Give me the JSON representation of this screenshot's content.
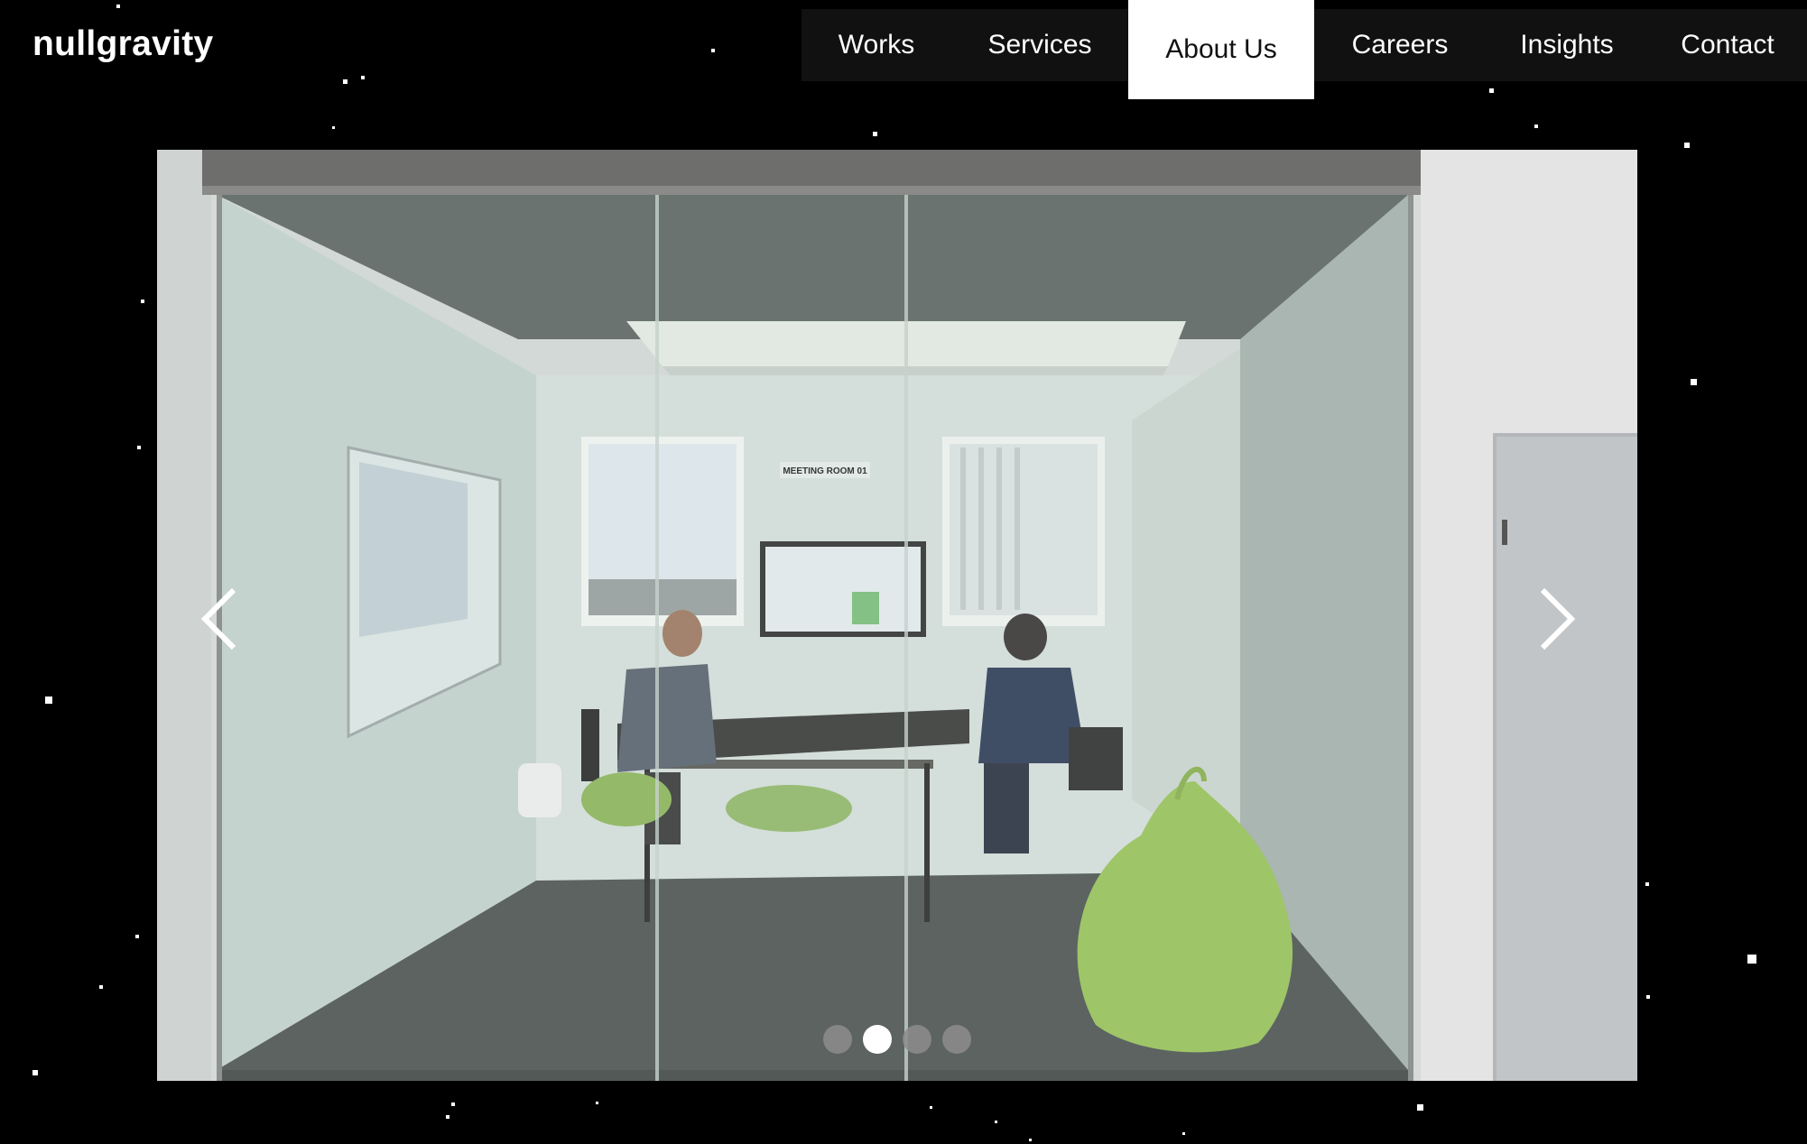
{
  "brand": {
    "logo_text": "nullgravity"
  },
  "nav": {
    "items": [
      {
        "label": "Works",
        "active": false
      },
      {
        "label": "Services",
        "active": false
      },
      {
        "label": "About Us",
        "active": true
      },
      {
        "label": "Careers",
        "active": false
      },
      {
        "label": "Insights",
        "active": false
      },
      {
        "label": "Contact",
        "active": false
      }
    ]
  },
  "slider": {
    "sign_text": "MEETING ROOM 01",
    "prev_icon": "chevron-left-icon",
    "next_icon": "chevron-right-icon",
    "slide_count": 4,
    "active_slide_index": 1
  },
  "colors": {
    "background": "#000000",
    "nav_bg": "#111111",
    "nav_active_bg": "#ffffff",
    "beanbag": "#9ac35a"
  }
}
